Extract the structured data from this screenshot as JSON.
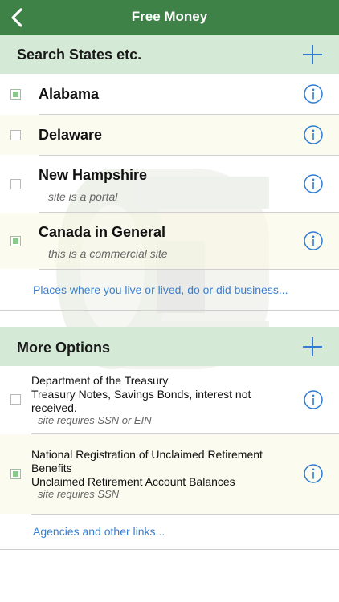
{
  "nav": {
    "title": "Free Money"
  },
  "states": {
    "section_title": "Search States etc.",
    "items": [
      {
        "name": "Alabama",
        "subtitle": "",
        "checked": true
      },
      {
        "name": "Delaware",
        "subtitle": "",
        "checked": false
      },
      {
        "name": "New Hampshire",
        "subtitle": "site is a portal",
        "checked": false
      },
      {
        "name": "Canada in General",
        "subtitle": "this is a commercial site",
        "checked": true
      }
    ],
    "footer_link": "Places where you live or lived, do or did business..."
  },
  "more_options": {
    "section_title": "More Options",
    "items": [
      {
        "line1": "Department of the Treasury",
        "line2": "Treasury Notes, Savings Bonds, interest not received.",
        "note": "site requires SSN or EIN",
        "checked": false
      },
      {
        "line1": "National Registration of Unclaimed Retirement Benefits",
        "line2": "Unclaimed Retirement Account Balances",
        "note": "site requires SSN",
        "checked": true
      }
    ],
    "footer_link": "Agencies and other links..."
  },
  "colors": {
    "nav_bg": "#3f8248",
    "section_bg": "#d5ead6",
    "accent_blue": "#2f7bd4",
    "checked_fill": "#8cc88c"
  },
  "icons": {
    "back": "chevron-left-icon",
    "add": "plus-icon",
    "info": "info-circle-icon"
  }
}
